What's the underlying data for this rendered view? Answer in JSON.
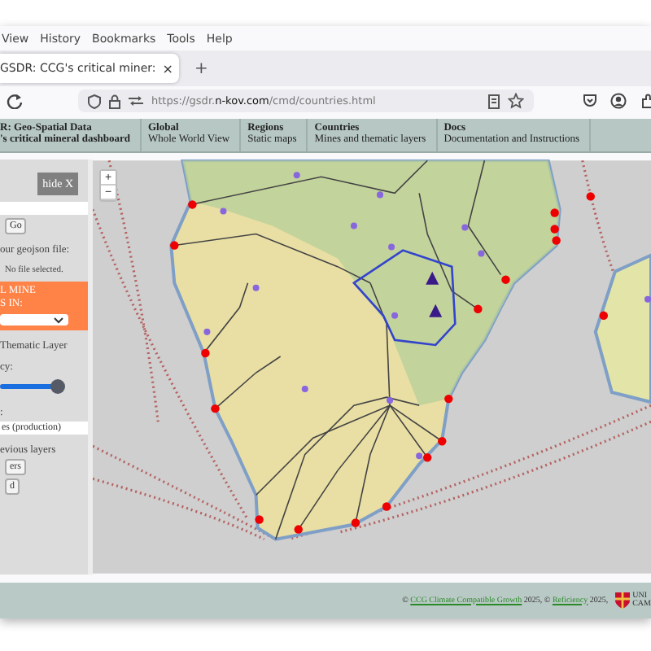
{
  "menu_bar": [
    "View",
    "History",
    "Bookmarks",
    "Tools",
    "Help"
  ],
  "tabs": [
    {
      "title": "GSDR: CCG's critical miner:",
      "close": "×",
      "selected": true
    }
  ],
  "new_tab": "+",
  "address_bar": {
    "url": "https://gsdr.**n-kov.com**/cmd/countries.html"
  },
  "site_nav": [
    {
      "kind": "brand",
      "title": "R: Geo-Spatial Data",
      "subtitle": "'s critical mineral dashboard"
    },
    {
      "kind": "link",
      "title": "Global",
      "subtitle": "Whole World View"
    },
    {
      "kind": "link",
      "title": "Regions",
      "subtitle": "Static maps"
    },
    {
      "kind": "link",
      "title": "Countries",
      "subtitle": "Mines and thematic layers"
    },
    {
      "kind": "link",
      "title": "Docs",
      "subtitle": "Documentation and Instructions"
    }
  ],
  "sidebar": [
    {
      "kind": "hide",
      "label": "hide X"
    },
    {
      "kind": "field"
    },
    {
      "kind": "button",
      "label": "Go"
    },
    {
      "kind": "text",
      "text": "our geojson file:"
    },
    {
      "kind": "note",
      "text": "No file selected."
    },
    {
      "kind": "panel",
      "lines": [
        "L MINE",
        "S IN:"
      ]
    },
    {
      "kind": "text",
      "text": "Thematic Layer"
    },
    {
      "kind": "text",
      "text": "cy:"
    },
    {
      "kind": "slider",
      "level": 0.95
    },
    {
      "kind": "text",
      "text": ":"
    },
    {
      "kind": "field",
      "value": "es (production)"
    },
    {
      "kind": "text",
      "text": "evious layers"
    },
    {
      "kind": "button",
      "label": "ers"
    },
    {
      "kind": "button",
      "label": "d"
    }
  ],
  "map": {
    "zoom_buttons": [
      "+",
      "−"
    ]
  },
  "footer": {
    "parts": [
      {
        "kind": "text",
        "text": "©"
      },
      {
        "kind": "link",
        "text": "CCG Climate Compatible Growth"
      },
      {
        "kind": "text",
        "text": "2025, ©"
      },
      {
        "kind": "link",
        "text": "Reficiency"
      },
      {
        "kind": "text",
        "text": "2025,"
      }
    ],
    "logo_lines": [
      "UNI",
      "CAM"
    ]
  }
}
